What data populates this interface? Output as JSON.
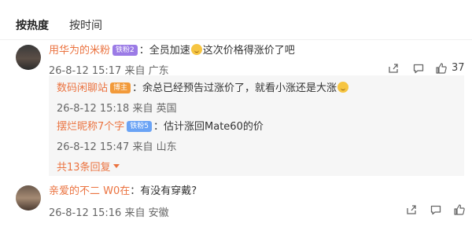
{
  "tabs": {
    "hot": "按热度",
    "time": "按时间"
  },
  "comments": [
    {
      "user": "用华为的米粉",
      "badge": "铁粉2",
      "text_before_emoji": "：全员加速",
      "text_after_emoji": "这次价格得涨价了吧",
      "emoji_icon": "grin-emoji-icon",
      "time": "26-8-12 15:17",
      "location": "来自 广东",
      "likes": "37",
      "replies": [
        {
          "user": "数码闲聊站",
          "badge": "博主",
          "text": "：余总已经预告过涨价了，就看小涨还是大涨",
          "emoji_icon": "smirk-emoji-icon",
          "time": "26-8-12 15:18",
          "location": "来自 英国"
        },
        {
          "user": "摆烂昵称7个字",
          "badge": "铁粉5",
          "text": "：估计涨回Mate60的价",
          "time": "26-8-12 15:47",
          "location": "来自 山东"
        }
      ],
      "more_replies": "共13条回复"
    },
    {
      "user": "亲爱的不二 W0在",
      "text": "：有没有穿戴?",
      "time": "26-8-12 15:16",
      "location": "来自 安徽"
    }
  ],
  "colors": {
    "username": "#eb7340",
    "reply_bg": "#f6f6f6"
  }
}
